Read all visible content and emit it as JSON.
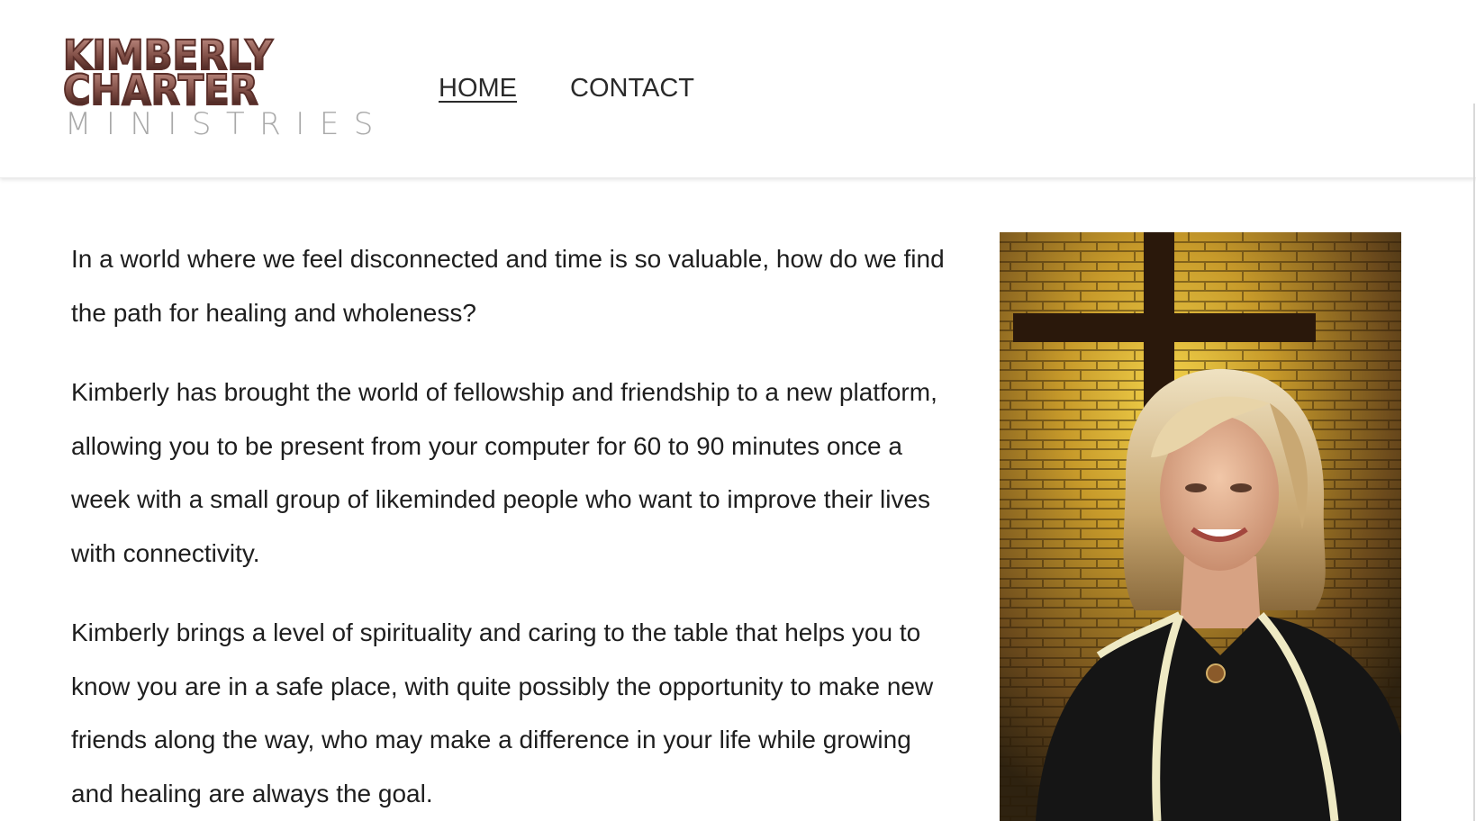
{
  "brand": {
    "logo_line1": "KIMBERLY",
    "logo_line2": "CHARTER",
    "logo_line3": "MINISTRIES",
    "logo_color": "#6b3a33",
    "logo_sub_color": "#a9a9a9"
  },
  "nav": {
    "items": [
      {
        "label": "HOME",
        "active": true
      },
      {
        "label": "CONTACT",
        "active": false
      }
    ]
  },
  "main": {
    "paragraphs": [
      "In a world where we feel disconnected and time is so valuable, how do we find the path for healing and wholeness?",
      "Kimberly has brought the world of fellowship and friendship to a new platform, allowing you to be present from your computer for 60 to 90 minutes once a week with a small group of likeminded people who want to improve their lives with connectivity.",
      "Kimberly brings a level of spirituality and caring to the table that helps you to know you are in a safe place, with quite possibly the opportunity to make new friends along the way, who may make a difference in your life while growing and healing are always the goal."
    ]
  },
  "photo": {
    "subject_icon": "portrait-photo",
    "background_icon": "cross-icon"
  }
}
